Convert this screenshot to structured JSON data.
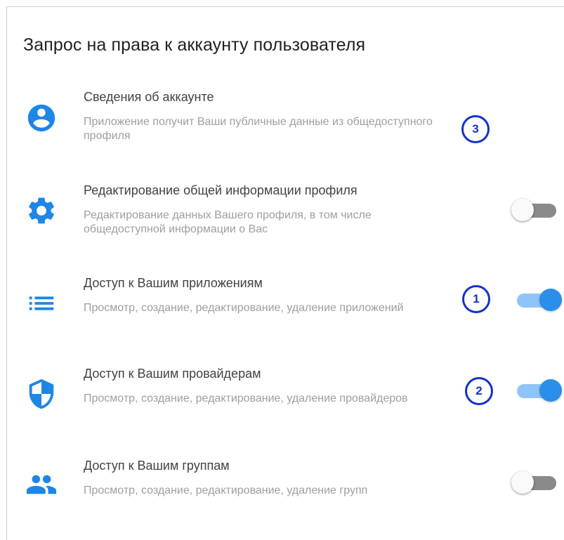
{
  "title": "Запрос на права к аккаунту пользователя",
  "colors": {
    "accent": "#2b8ee8",
    "annotation": "#1233c8",
    "icon": "#1e86e6"
  },
  "items": [
    {
      "icon": "account-circle-icon",
      "title": "Сведения об аккаунте",
      "description": "Приложение получит Ваши публичные данные из общедоступного профиля",
      "toggle": null,
      "badge": "3"
    },
    {
      "icon": "gear-icon",
      "title": "Редактирование общей информации профиля",
      "description": "Редактирование данных Вашего профиля, в том числе общедоступной информации о Вас",
      "toggle": false,
      "badge": null
    },
    {
      "icon": "list-icon",
      "title": "Доступ к Вашим приложениям",
      "description": "Просмотр, создание, редактирование, удаление приложений",
      "toggle": true,
      "badge": "1"
    },
    {
      "icon": "shield-icon",
      "title": "Доступ к Вашим провайдерам",
      "description": "Просмотр, создание, редактирование, удаление провайдеров",
      "toggle": true,
      "badge": "2"
    },
    {
      "icon": "group-icon",
      "title": "Доступ к Вашим группам",
      "description": "Просмотр, создание, редактирование, удаление групп",
      "toggle": false,
      "badge": null
    }
  ]
}
